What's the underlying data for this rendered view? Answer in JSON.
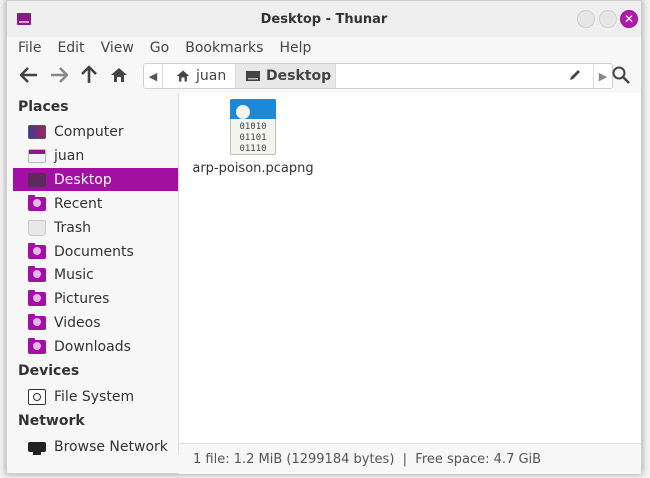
{
  "window": {
    "title": "Desktop - Thunar"
  },
  "menubar": {
    "items": [
      "File",
      "Edit",
      "View",
      "Go",
      "Bookmarks",
      "Help"
    ]
  },
  "toolbar": {
    "pathbar": {
      "crumbs": [
        "juan",
        "Desktop"
      ]
    }
  },
  "sidebar": {
    "sections": [
      {
        "title": "Places",
        "items": [
          {
            "label": "Computer",
            "icon": "computer-icon"
          },
          {
            "label": "juan",
            "icon": "home-folder-icon"
          },
          {
            "label": "Desktop",
            "icon": "desktop-icon",
            "active": true
          },
          {
            "label": "Recent",
            "icon": "recent-folder-icon"
          },
          {
            "label": "Trash",
            "icon": "trash-icon"
          },
          {
            "label": "Documents",
            "icon": "documents-folder-icon"
          },
          {
            "label": "Music",
            "icon": "music-folder-icon"
          },
          {
            "label": "Pictures",
            "icon": "pictures-folder-icon"
          },
          {
            "label": "Videos",
            "icon": "videos-folder-icon"
          },
          {
            "label": "Downloads",
            "icon": "downloads-folder-icon"
          }
        ]
      },
      {
        "title": "Devices",
        "items": [
          {
            "label": "File System",
            "icon": "drive-icon"
          }
        ]
      },
      {
        "title": "Network",
        "items": [
          {
            "label": "Browse Network",
            "icon": "network-icon"
          }
        ]
      }
    ]
  },
  "content": {
    "files": [
      {
        "name": "arp-poison.pcapng",
        "icon": "pcap-file-icon",
        "bits": [
          "01010",
          "01101",
          "01110"
        ]
      }
    ]
  },
  "statusbar": {
    "text": "1 file: 1.2 MiB (1299184 bytes)  |  Free space: 4.7 GiB"
  },
  "colors": {
    "accent": "#a30ea3",
    "close_button": "#b01aa8"
  }
}
